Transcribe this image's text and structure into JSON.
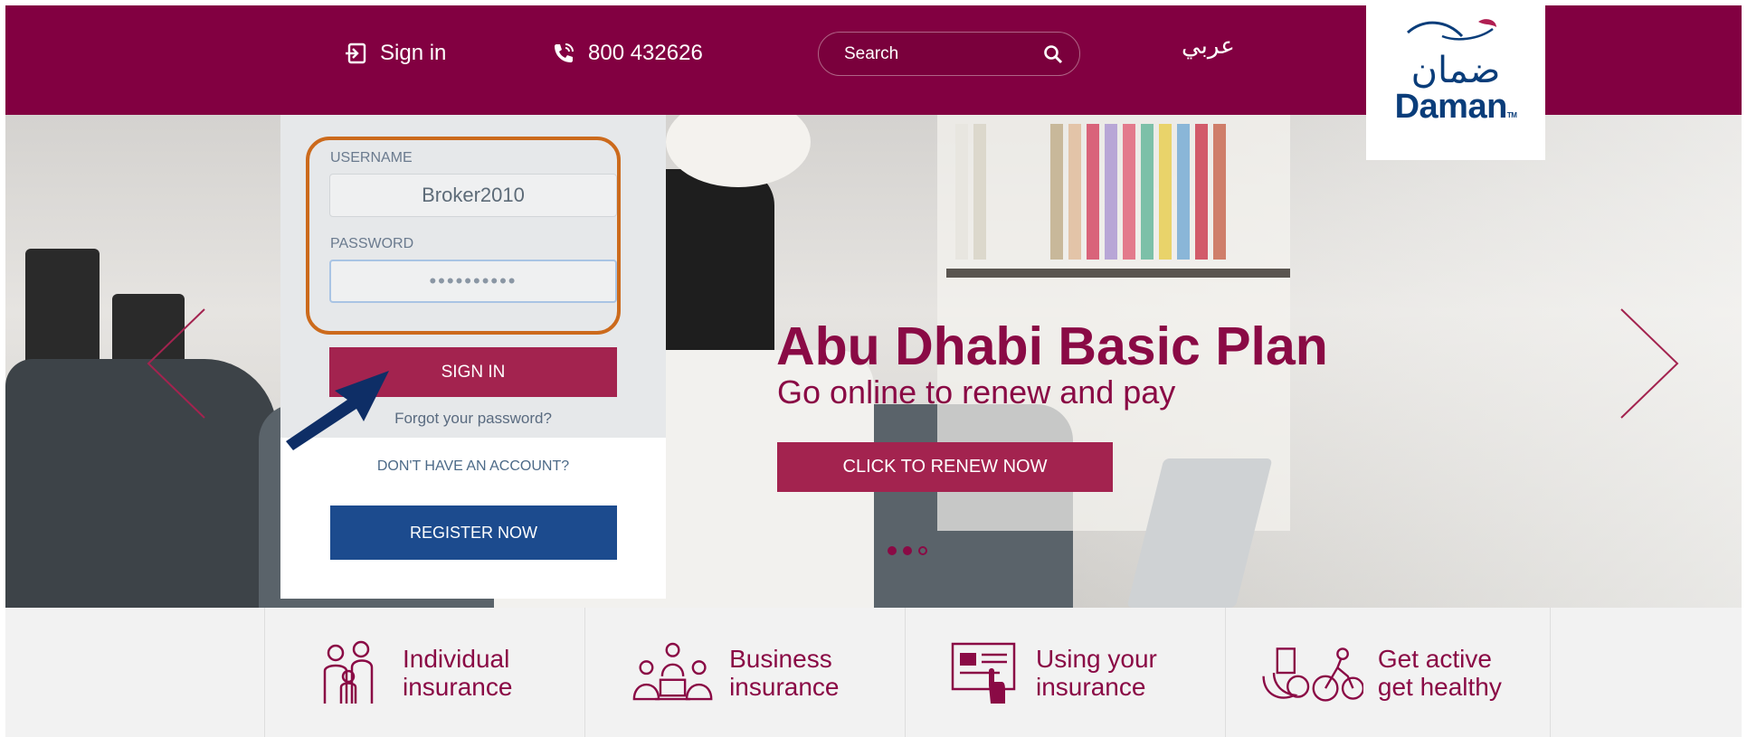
{
  "header": {
    "signin_label": "Sign in",
    "phone": "800 432626",
    "search_placeholder": "Search",
    "language_label": "عربي",
    "logo_arabic": "ضمان",
    "logo_english": "Daman",
    "logo_tm": "TM"
  },
  "login": {
    "username_label": "USERNAME",
    "username_value": "Broker2010",
    "password_label": "PASSWORD",
    "password_value": "••••••••••",
    "signin_label": "SIGN IN",
    "forgot_label": "Forgot your password?",
    "no_account_label": "DON'T HAVE AN ACCOUNT?",
    "register_label": "REGISTER NOW"
  },
  "hero": {
    "title": "Abu Dhabi Basic Plan",
    "subtitle": "Go online to renew and pay",
    "cta_label": "CLICK TO RENEW NOW"
  },
  "tiles": [
    {
      "line1": "Individual",
      "line2": "insurance",
      "icon": "family-icon"
    },
    {
      "line1": "Business",
      "line2": "insurance",
      "icon": "team-icon"
    },
    {
      "line1": "Using your",
      "line2": "insurance",
      "icon": "card-icon"
    },
    {
      "line1": "Get active",
      "line2": "get healthy",
      "icon": "cycling-icon"
    }
  ],
  "colors": {
    "brand": "#820041",
    "accent": "#a3234f",
    "register": "#1c4b8e",
    "highlight": "#cc6a1c"
  }
}
